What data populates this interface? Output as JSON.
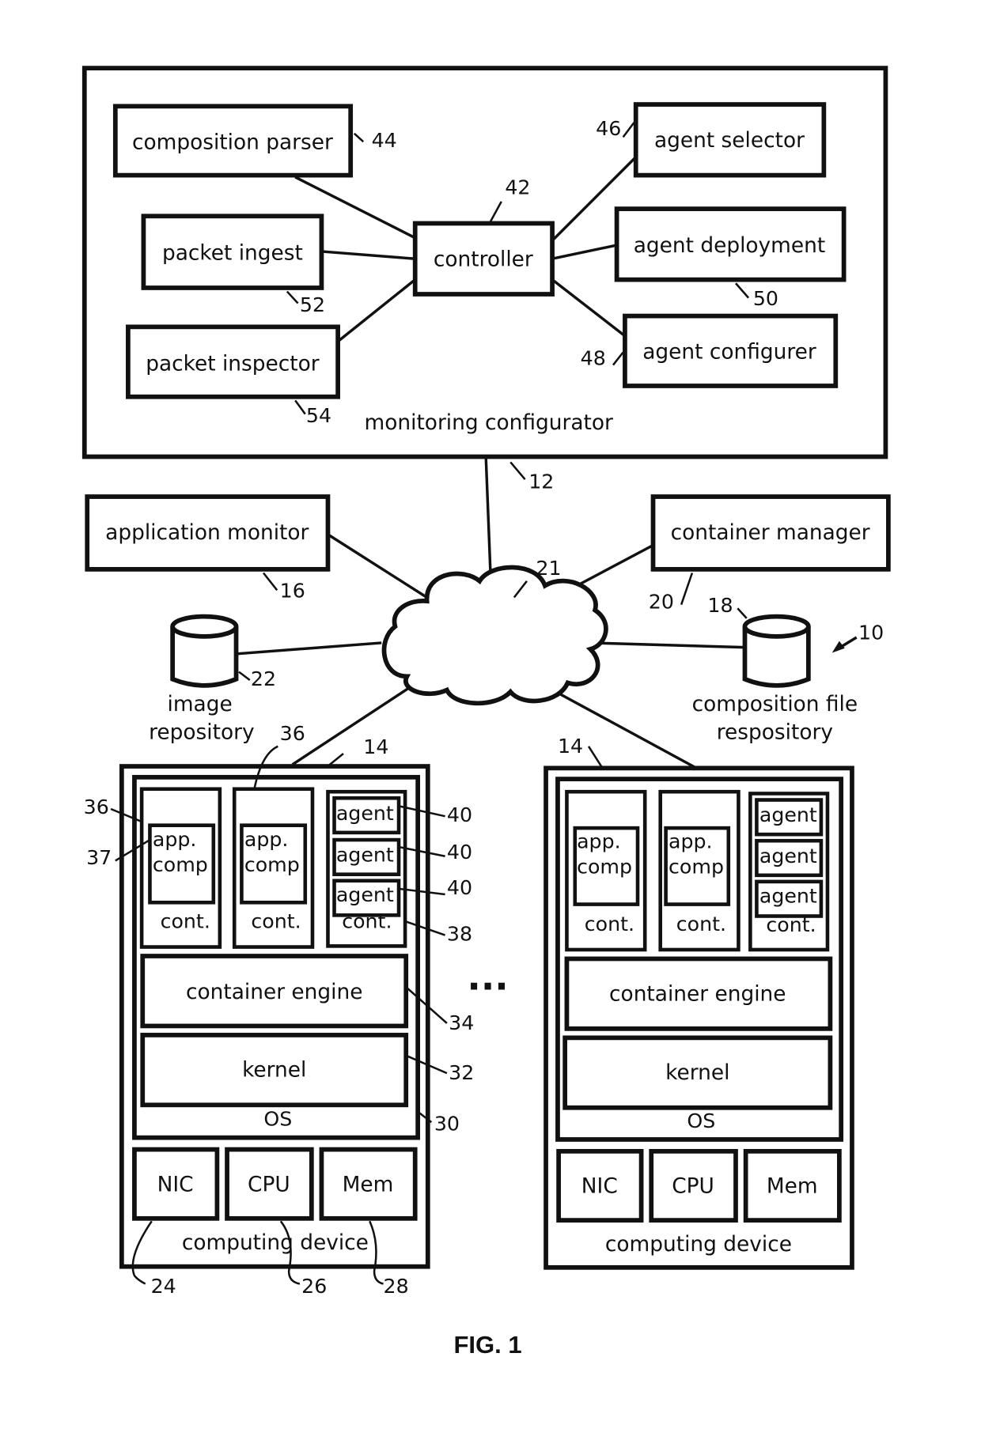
{
  "figure_label": "FIG. 1",
  "system_ref": "10",
  "monitoring_configurator": {
    "label": "monitoring configurator",
    "ref": "12",
    "components": {
      "composition_parser": {
        "label": "composition parser",
        "ref": "44"
      },
      "packet_ingest": {
        "label": "packet ingest",
        "ref": "52"
      },
      "packet_inspector": {
        "label": "packet inspector",
        "ref": "54"
      },
      "controller": {
        "label": "controller",
        "ref": "42"
      },
      "agent_selector": {
        "label": "agent selector",
        "ref": "46"
      },
      "agent_deployment": {
        "label": "agent deployment",
        "ref": "50"
      },
      "agent_configurer": {
        "label": "agent configurer",
        "ref": "48"
      }
    }
  },
  "application_monitor": {
    "label": "application monitor",
    "ref": "16"
  },
  "container_manager": {
    "label": "container manager",
    "ref": "20"
  },
  "network": {
    "ref": "21"
  },
  "image_repository": {
    "line1": "image",
    "line2": "repository",
    "ref": "22"
  },
  "composition_repository": {
    "line1": "composition file",
    "line2": "respository",
    "ref": "18"
  },
  "ellipsis": "...",
  "devices": [
    {
      "ref": "14",
      "label": "computing device",
      "os": {
        "label": "OS",
        "ref": "30"
      },
      "kernel": {
        "label": "kernel",
        "ref": "32"
      },
      "engine": {
        "label": "container engine",
        "ref": "34"
      },
      "containers": {
        "c1": {
          "label": "cont.",
          "ref": "36",
          "app_line1": "app.",
          "app_line2": "comp",
          "app_ref": "37"
        },
        "c2": {
          "label": "cont.",
          "ref": "36",
          "app_line1": "app.",
          "app_line2": "comp"
        },
        "c3": {
          "label": "cont.",
          "ref": "38",
          "agents": [
            "agent",
            "agent",
            "agent"
          ],
          "agent_ref": "40"
        }
      },
      "hardware": {
        "nic": {
          "label": "NIC",
          "ref": "24"
        },
        "cpu": {
          "label": "CPU",
          "ref": "26"
        },
        "mem": {
          "label": "Mem",
          "ref": "28"
        }
      }
    },
    {
      "ref": "14",
      "label": "computing device",
      "os": {
        "label": "OS"
      },
      "kernel": {
        "label": "kernel"
      },
      "engine": {
        "label": "container engine"
      },
      "containers": {
        "c1": {
          "label": "cont.",
          "app_line1": "app.",
          "app_line2": "comp"
        },
        "c2": {
          "label": "cont.",
          "app_line1": "app.",
          "app_line2": "comp"
        },
        "c3": {
          "label": "cont.",
          "agents": [
            "agent",
            "agent",
            "agent"
          ]
        }
      },
      "hardware": {
        "nic": {
          "label": "NIC"
        },
        "cpu": {
          "label": "CPU"
        },
        "mem": {
          "label": "Mem"
        }
      }
    }
  ]
}
